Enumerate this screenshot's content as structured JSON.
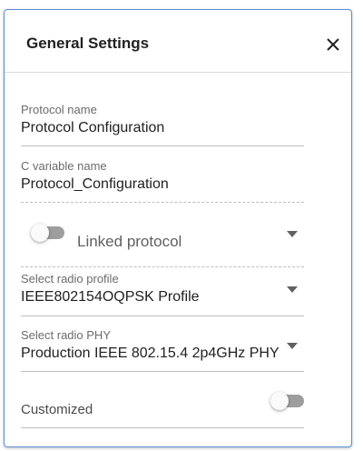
{
  "panel": {
    "title": "General Settings",
    "close_icon": "close-icon"
  },
  "fields": {
    "protocol_name": {
      "label": "Protocol name",
      "value": "Protocol Configuration"
    },
    "c_variable_name": {
      "label": "C variable name",
      "value": "Protocol_Configuration"
    },
    "linked_protocol": {
      "label": "Linked protocol",
      "enabled": false
    },
    "radio_profile": {
      "label": "Select radio profile",
      "value": "IEEE802154OQPSK Profile"
    },
    "radio_phy": {
      "label": "Select radio PHY",
      "value": "Production IEEE 802.15.4 2p4GHz PHY"
    },
    "customized": {
      "label": "Customized",
      "enabled": false
    }
  },
  "colors": {
    "panel_border": "#5b8fd6",
    "switch_off_track": "#9e9e9e",
    "text_primary": "#212121",
    "text_secondary": "#6b6b6b"
  }
}
